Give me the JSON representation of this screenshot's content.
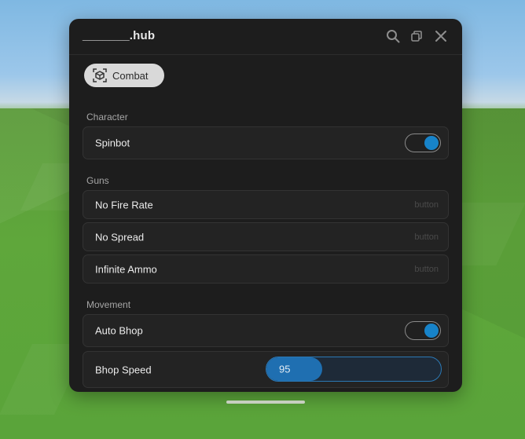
{
  "window": {
    "title": "_______.hub",
    "controls": [
      "search-icon",
      "restore-icon",
      "close-icon"
    ]
  },
  "tabs": [
    {
      "label": "Combat",
      "icon": "cube-icon",
      "active": true
    }
  ],
  "sections": {
    "character": {
      "label": "Character",
      "items": [
        {
          "label": "Spinbot",
          "type": "toggle",
          "on": true
        }
      ]
    },
    "guns": {
      "label": "Guns",
      "items": [
        {
          "label": "No Fire Rate",
          "type": "button",
          "hint": "button"
        },
        {
          "label": "No Spread",
          "type": "button",
          "hint": "button"
        },
        {
          "label": "Infinite Ammo",
          "type": "button",
          "hint": "button"
        }
      ]
    },
    "movement": {
      "label": "Movement",
      "items": [
        {
          "label": "Auto Bhop",
          "type": "toggle",
          "on": true
        },
        {
          "label": "Bhop Speed",
          "type": "slider",
          "value": "95",
          "fill_fraction": 0.32
        }
      ]
    }
  },
  "colors": {
    "accent": "#1783c9",
    "window_bg": "#1d1d1d",
    "row_bg": "#232323"
  }
}
